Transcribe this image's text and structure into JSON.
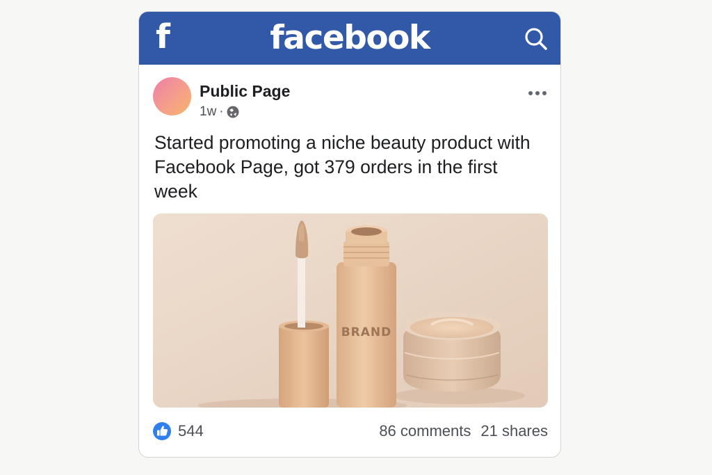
{
  "app": {
    "brand_letter": "f",
    "brand_name": "facebook"
  },
  "icons": {
    "logo": "facebook-f-icon",
    "search": "search-icon",
    "more": "more-options-icon",
    "privacy": "public-globe-icon",
    "like": "like-thumbs-up-icon"
  },
  "colors": {
    "brand": "#3159a7",
    "like_badge": "#2f80ed",
    "text": "#1c1e21",
    "secondary_text": "#4b4f56"
  },
  "post": {
    "author": "Public Page",
    "time": "1w",
    "separator": "·",
    "text": "Started promoting a niche beauty product with Facebook Page, got 379 orders in the first week",
    "image": {
      "label": "BRAND"
    },
    "stats": {
      "likes": "544",
      "comments": "86 comments",
      "shares": "21 shares"
    }
  }
}
